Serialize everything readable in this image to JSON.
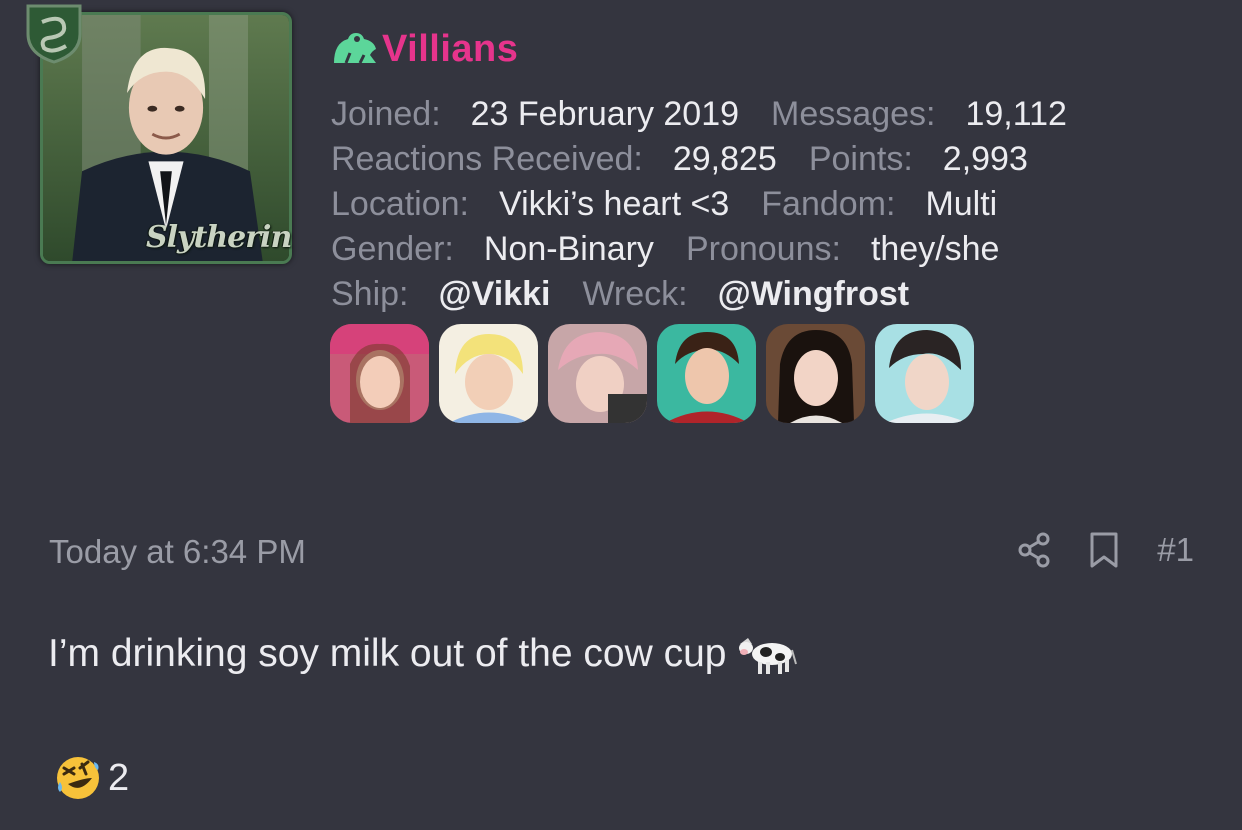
{
  "user": {
    "name": "Villians",
    "name_color": "#e6348c",
    "avatar_caption": "Slytherin"
  },
  "profile": {
    "joined_label": "Joined:",
    "joined_value": "23 February 2019",
    "messages_label": "Messages:",
    "messages_value": "19,112",
    "reactions_label": "Reactions Received:",
    "reactions_value": "29,825",
    "points_label": "Points:",
    "points_value": "2,993",
    "location_label": "Location:",
    "location_value": "Vikki’s heart <3",
    "fandom_label": "Fandom:",
    "fandom_value": "Multi",
    "gender_label": "Gender:",
    "gender_value": "Non-Binary",
    "pronouns_label": "Pronouns:",
    "pronouns_value": "they/she",
    "ship_label": "Ship:",
    "ship_value": "@Vikki",
    "wreck_label": "Wreck:",
    "wreck_value": "@Wingfrost"
  },
  "post": {
    "timestamp": "Today at 6:34 PM",
    "number": "#1",
    "body": "I’m drinking soy milk out of the cow cup",
    "body_emoji": "cow-icon"
  },
  "reaction": {
    "icon": "rolling-laughing-icon",
    "count": "2"
  },
  "icons": {
    "share": "share-icon",
    "bookmark": "bookmark-icon",
    "group": "frog-icon"
  }
}
